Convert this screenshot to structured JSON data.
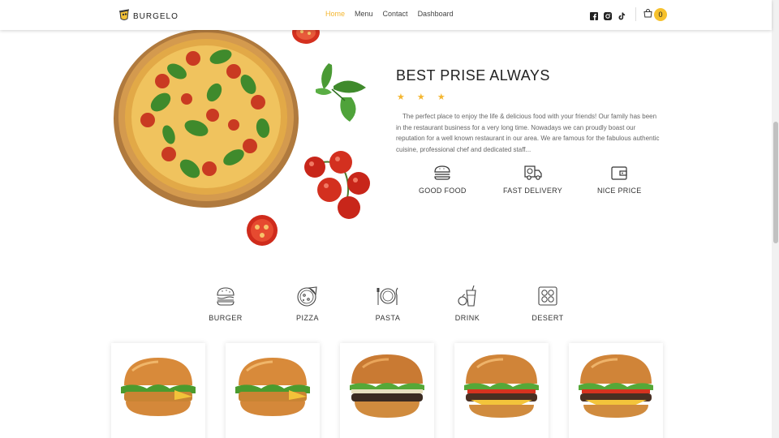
{
  "header": {
    "logo_text": "BURGELO",
    "nav": [
      "Home",
      "Menu",
      "Contact",
      "Dashboard"
    ],
    "active_nav": "Home",
    "social_icons": [
      "facebook-icon",
      "instagram-icon",
      "tiktok-icon"
    ],
    "cart_count": "0"
  },
  "hero": {
    "title": "BEST PRISE ALWAYS",
    "stars": "★ ★ ★",
    "description": "The perfect place to enjoy the life & delicious food with your friends! Our family has been in the restaurant business for a very long time. Nowadays we can proudly boast our reputation for a well known restaurant in our area. We are famous for the fabulous authentic cuisine, professional chef and dedicated staff...",
    "features": [
      {
        "label": "GOOD FOOD",
        "icon": "burger-icon"
      },
      {
        "label": "FAST DELIVERY",
        "icon": "delivery-truck-icon"
      },
      {
        "label": "NICE PRICE",
        "icon": "wallet-icon"
      }
    ]
  },
  "categories": [
    {
      "label": "BURGER",
      "icon": "burger-icon"
    },
    {
      "label": "PIZZA",
      "icon": "pizza-icon"
    },
    {
      "label": "PASTA",
      "icon": "plate-icon"
    },
    {
      "label": "DRINK",
      "icon": "drink-icon"
    },
    {
      "label": "DESERT",
      "icon": "desert-icon"
    }
  ],
  "products": [
    {
      "image": "chicken-burger-image"
    },
    {
      "image": "chicken-burger-image"
    },
    {
      "image": "beef-burger-image"
    },
    {
      "image": "cheeseburger-image"
    },
    {
      "image": "cheeseburger-image"
    }
  ],
  "colors": {
    "accent": "#f4b630",
    "text": "#333333"
  }
}
